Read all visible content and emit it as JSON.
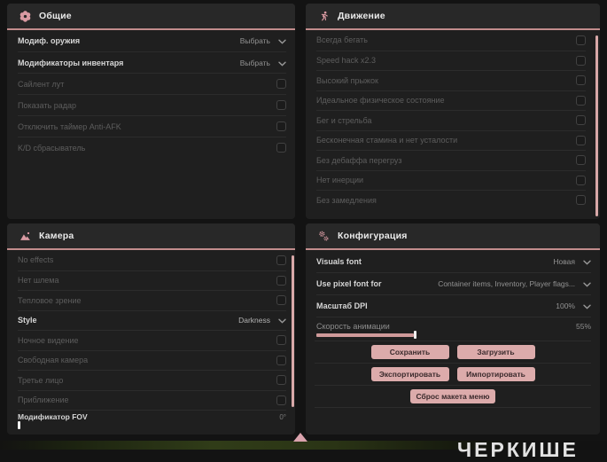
{
  "background": {
    "watermark": "ЧЕРКИШЕ"
  },
  "colors": {
    "accent_pink": "#cf9a9a",
    "header_underline": "#c28d8d",
    "button_pink": "#dcabab",
    "scrollbar_pink": "#d8a8a8",
    "panel_bg": "#1f1f1f",
    "page_bg": "#131313",
    "dim_text": "#5d5d5d"
  },
  "panels": {
    "general": {
      "title": "Общие",
      "icon": "flower-icon",
      "rows": [
        {
          "label": "Модиф. оружия",
          "value": "Выбрать"
        },
        {
          "label": "Модификаторы инвентаря",
          "value": "Выбрать"
        },
        {
          "label": "Сайлент лут"
        },
        {
          "label": "Показать радар"
        },
        {
          "label": "Отключить таймер Anti-AFK"
        },
        {
          "label": "K/D сбрасыватель"
        }
      ]
    },
    "movement": {
      "title": "Движение",
      "icon": "runner-icon",
      "rows": [
        {
          "label": "Всегда бегать"
        },
        {
          "label": "Speed hack x2.3"
        },
        {
          "label": "Высокий прыжок"
        },
        {
          "label": "Идеальное физическое состояние"
        },
        {
          "label": "Бег и стрельба"
        },
        {
          "label": "Бесконечная стамина и нет усталости"
        },
        {
          "label": "Без дебаффа перегруз"
        },
        {
          "label": "Нет инерции"
        },
        {
          "label": "Без замедления"
        }
      ]
    },
    "camera": {
      "title": "Камера",
      "icon": "mountain-icon",
      "rows": [
        {
          "label": "No effects"
        },
        {
          "label": "Нет шлема"
        },
        {
          "label": "Тепловое зрение"
        },
        {
          "label": "Style",
          "value": "Darkness"
        },
        {
          "label": "Ночное видение"
        },
        {
          "label": "Свободная камера"
        },
        {
          "label": "Третье лицо"
        },
        {
          "label": "Приближение"
        }
      ],
      "fov": {
        "label": "Модификатор FOV",
        "value": "0°",
        "percent": 0
      }
    },
    "config": {
      "title": "Конфигурация",
      "icon": "gears-icon",
      "rows": [
        {
          "label": "Visuals font",
          "value": "Новая"
        },
        {
          "label": "Use pixel font for",
          "value": "Container items, Inventory, Player flags..."
        },
        {
          "label": "Масштаб DPI",
          "value": "100%"
        }
      ],
      "slider": {
        "label": "Скорость анимации",
        "value": "55%",
        "percent": 55
      },
      "buttons": {
        "save": "Сохранить",
        "load": "Загрузить",
        "export": "Экспортировать",
        "import": "Импортировать",
        "reset": "Сброс макета меню"
      }
    }
  }
}
